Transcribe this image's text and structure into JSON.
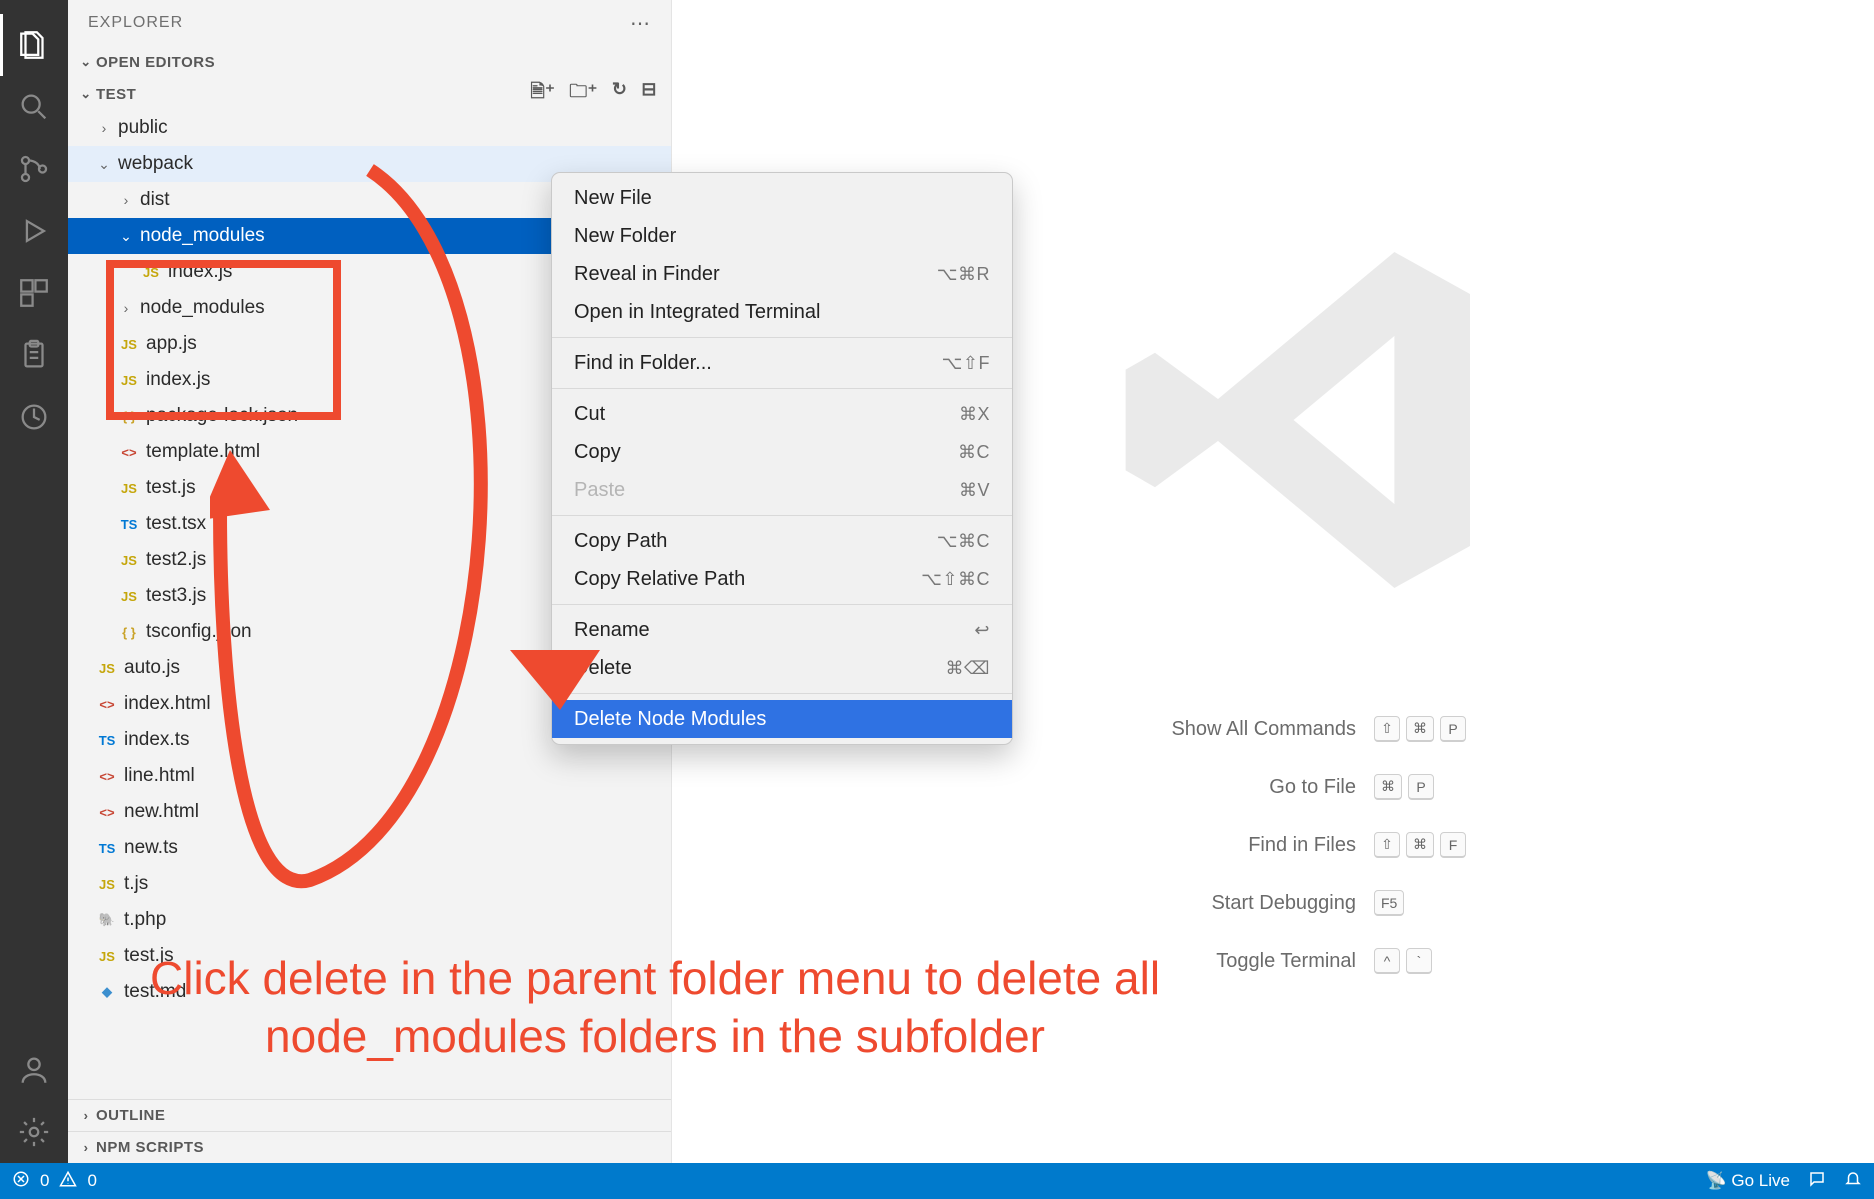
{
  "sidebar": {
    "title": "EXPLORER",
    "open_editors": "OPEN EDITORS",
    "workspace": "TEST",
    "outline": "OUTLINE",
    "npm_scripts": "NPM SCRIPTS"
  },
  "tree": {
    "public": "public",
    "webpack": "webpack",
    "dist": "dist",
    "node_modules_sel": "node_modules",
    "index_js_inner": "index.js",
    "node_modules2": "node_modules",
    "app_js": "app.js",
    "index_js": "index.js",
    "pkg_lock": "package-lock.json",
    "template_html": "template.html",
    "test_js": "test.js",
    "test_tsx": "test.tsx",
    "test2_js": "test2.js",
    "test3_js": "test3.js",
    "tsconfig": "tsconfig.json",
    "auto_js": "auto.js",
    "index_html": "index.html",
    "index_ts": "index.ts",
    "line_html": "line.html",
    "new_html": "new.html",
    "new_ts": "new.ts",
    "t_js": "t.js",
    "t_php": "t.php",
    "test_js2": "test.js",
    "test_md": "test.md"
  },
  "ctx": {
    "new_file": "New File",
    "new_folder": "New Folder",
    "reveal": "Reveal in Finder",
    "reveal_sc": "⌥⌘R",
    "open_term": "Open in Integrated Terminal",
    "find": "Find in Folder...",
    "find_sc": "⌥⇧F",
    "cut": "Cut",
    "cut_sc": "⌘X",
    "copy": "Copy",
    "copy_sc": "⌘C",
    "paste": "Paste",
    "paste_sc": "⌘V",
    "copy_path": "Copy Path",
    "copy_path_sc": "⌥⌘C",
    "copy_rel": "Copy Relative Path",
    "copy_rel_sc": "⌥⇧⌘C",
    "rename": "Rename",
    "rename_sc": "↩",
    "delete": "Delete",
    "delete_sc": "⌘⌫",
    "del_node": "Delete Node Modules"
  },
  "welcome": {
    "cmd": "Show All Commands",
    "goto": "Go to File",
    "find": "Find in Files",
    "debug": "Start Debugging",
    "term": "Toggle Terminal",
    "k_shift": "⇧",
    "k_cmd": "⌘",
    "k_p": "P",
    "k_f": "F",
    "k_f5": "F5",
    "k_ctrl": "^",
    "k_grave": "`"
  },
  "status": {
    "errors": "0",
    "warnings": "0",
    "golive": "Go Live"
  },
  "annotation": {
    "line1": "Click delete in the parent folder menu to delete all",
    "line2": "node_modules folders in the subfolder"
  }
}
